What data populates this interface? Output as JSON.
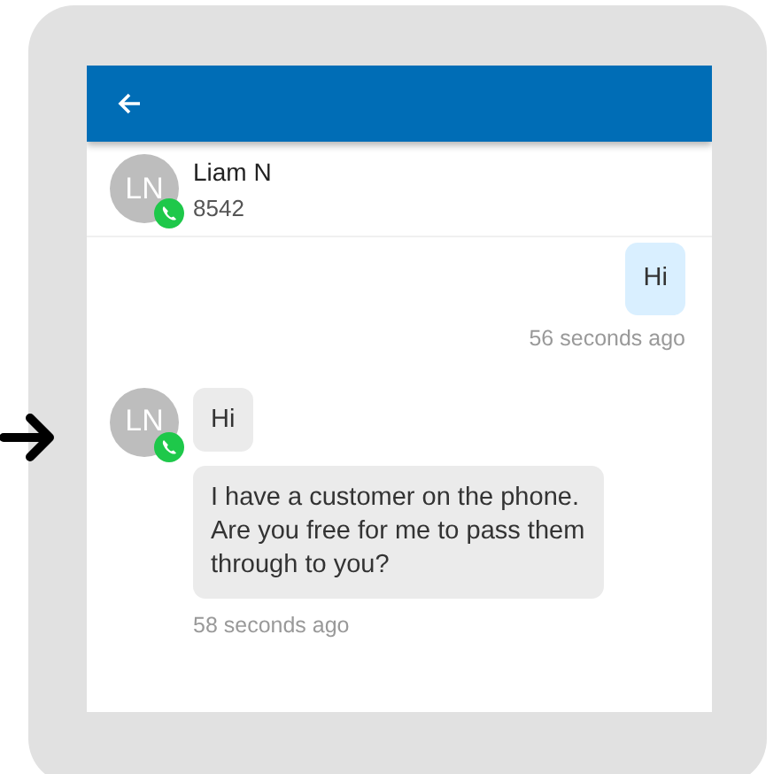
{
  "contact": {
    "initials": "LN",
    "name": "Liam N",
    "number": "8542"
  },
  "messages": [
    {
      "kind": "outgoing",
      "bubbles": [
        "Hi"
      ],
      "time": "56 seconds ago"
    },
    {
      "kind": "incoming",
      "initials": "LN",
      "bubbles": [
        "Hi",
        "I have a customer on the phone. Are you free for me to pass them through to you?"
      ],
      "time": "58 seconds ago"
    }
  ]
}
